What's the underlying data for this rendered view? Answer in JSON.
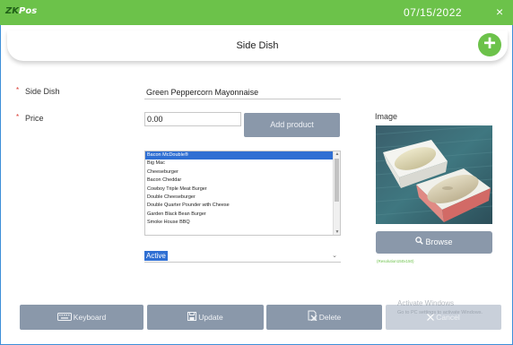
{
  "app": {
    "logo_prefix": "ZK",
    "logo_suffix": "Pos",
    "date": "07/15/2022",
    "close_glyph": "×"
  },
  "header": {
    "title": "Side Dish",
    "add_glyph": "+"
  },
  "form": {
    "side_dish_label": "Side Dish",
    "side_dish_value": "Green Peppercorn Mayonnaise",
    "price_label": "Price",
    "price_value": "0.00",
    "required_mark": "*",
    "add_product_label": "Add product",
    "products": [
      "Bacon McDouble®",
      "Big Mac",
      "Cheeseburger",
      "Bacon Cheddar",
      "Cowboy Triple Meat Burger",
      "Double Cheeseburger",
      "Double Quarter Pounder with Cheese",
      "Garden Black Bean Burger",
      "Smoke House BBQ"
    ],
    "selected_product": "Bacon McDouble®",
    "status_value": "Active"
  },
  "image_panel": {
    "label": "Image",
    "browse_label": "Browse",
    "resolution_note": "(Resolution150x150)"
  },
  "footer": {
    "keyboard_label": "Keyboard",
    "update_label": "Update",
    "delete_label": "Delete",
    "cancel_label": "Cancel"
  },
  "watermark": {
    "line1": "Activate Windows",
    "line2": "Go to PC settings to activate Windows."
  },
  "colors": {
    "accent_green": "#6cc24a",
    "button_grey": "#8a98aa",
    "selection_blue": "#2f6fd3",
    "required_red": "#d9372e"
  },
  "icons": [
    "close-icon",
    "plus-icon",
    "search-icon",
    "keyboard-icon",
    "save-icon",
    "delete-icon",
    "cancel-icon"
  ]
}
